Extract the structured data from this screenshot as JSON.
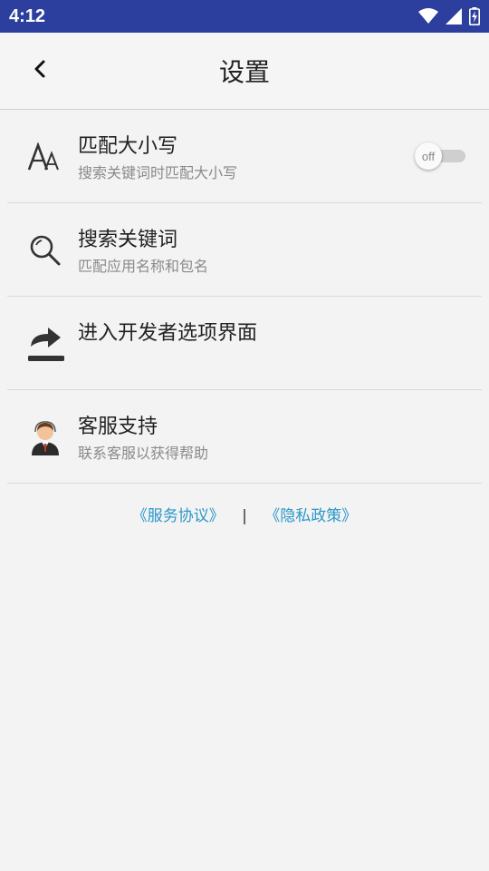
{
  "status_bar": {
    "time": "4:12",
    "icons": [
      "wifi-icon",
      "signal-icon",
      "battery-charging-icon"
    ],
    "background": "#2c3e9e"
  },
  "app_bar": {
    "title": "设置",
    "back_icon": "chevron-left-icon"
  },
  "settings": {
    "items": [
      {
        "icon": "font-case-icon",
        "title": "匹配大小写",
        "subtitle": "搜索关键词时匹配大小写",
        "toggle": "off"
      },
      {
        "icon": "search-icon",
        "title": "搜索关键词",
        "subtitle": "匹配应用名称和包名"
      },
      {
        "icon": "share-arrow-icon",
        "title": "进入开发者选项界面",
        "subtitle": ""
      },
      {
        "icon": "customer-service-icon",
        "title": "客服支持",
        "subtitle": "联系客服以获得帮助"
      }
    ]
  },
  "footer": {
    "service_agreement": "《服务协议》",
    "separator": "|",
    "privacy_policy": "《隐私政策》",
    "link_color": "#2a97c9"
  }
}
